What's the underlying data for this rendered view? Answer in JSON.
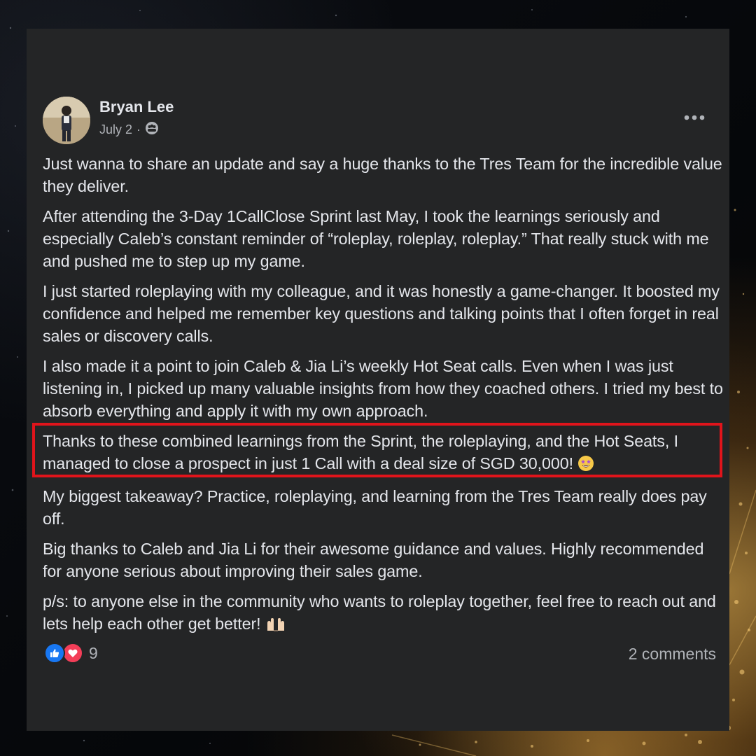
{
  "post": {
    "author": "Bryan Lee",
    "date": "July 2",
    "separator": "·",
    "audience_icon": "group-icon",
    "more_icon": "more-options-icon",
    "paragraphs": [
      "Just wanna to share an update and say a huge thanks to the Tres Team for the incredible value they deliver.",
      "After attending the 3-Day 1CallClose Sprint last May, I took the learnings seriously and especially Caleb’s constant reminder of “roleplay, roleplay, roleplay.” That really stuck with me and pushed me to step up my game.",
      "I just started roleplaying with my colleague, and it was honestly a game-changer. It boosted my confidence and helped me remember key questions and talking points that I often forget in real sales or discovery calls.",
      "I also made it a point to join Caleb & Jia Li’s weekly Hot Seat calls. Even when I was just listening in, I picked up many valuable insights from how they coached others. I tried my best to absorb everything and apply it with my own approach.",
      "Thanks to these combined learnings from the Sprint, the roleplaying, and the Hot Seats, I managed to close a prospect in just 1 Call with a deal size of SGD 30,000!",
      "My biggest takeaway? Practice, roleplaying, and learning from the Tres Team really does pay off.",
      "Big thanks to Caleb and Jia Li for their awesome guidance and values. Highly recommended for anyone serious about improving their sales game.",
      "p/s: to anyone else in the community who wants to roleplay together, feel free to reach out and lets help each other get better!"
    ],
    "emoji_highlight": "star-struck-emoji",
    "emoji_last": "raised-hands-emoji"
  },
  "footer": {
    "reaction_count": "9",
    "reaction_icons": [
      "like-icon",
      "love-icon"
    ],
    "comments": "2 comments"
  },
  "colors": {
    "card_bg": "#242526",
    "text_primary": "#e4e6eb",
    "text_secondary": "#b0b3b8",
    "highlight_border": "#e0141b",
    "like_blue": "#1877f2",
    "love_red": "#f33e58"
  }
}
